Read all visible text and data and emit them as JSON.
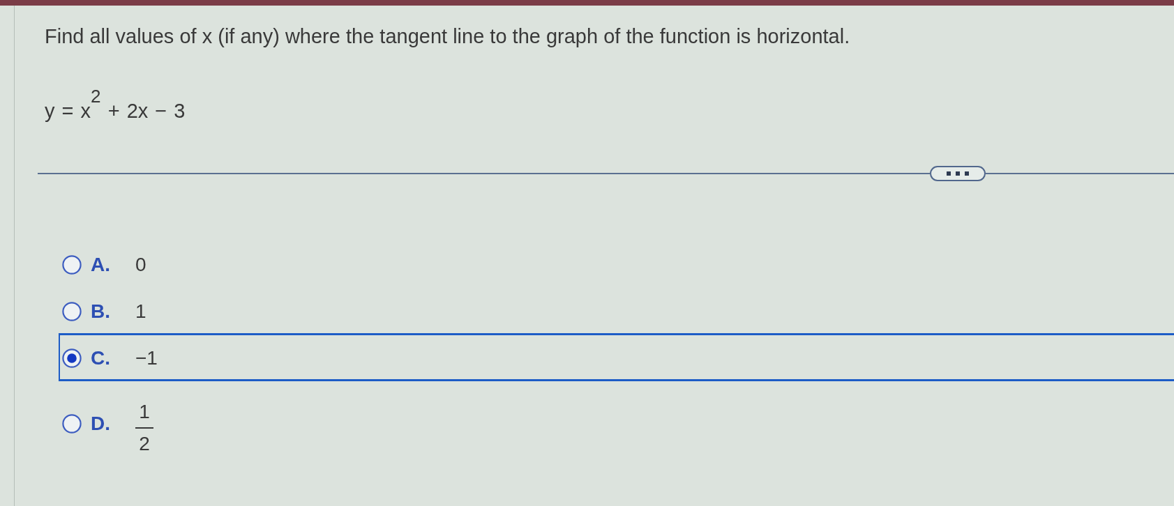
{
  "question": {
    "prompt": "Find all values of x (if any) where the tangent line to the graph of the function is horizontal.",
    "equation": "y = x$^{2}$ + 2x − 3"
  },
  "options": [
    {
      "kind": "text",
      "letter": "A.",
      "value": "0",
      "selected": false
    },
    {
      "kind": "text",
      "letter": "B.",
      "value": "1",
      "selected": false
    },
    {
      "kind": "text",
      "letter": "C.",
      "value": "−1",
      "selected": true
    },
    {
      "kind": "fraction",
      "letter": "D.",
      "numerator": "1",
      "denominator": "2",
      "selected": false
    }
  ]
}
